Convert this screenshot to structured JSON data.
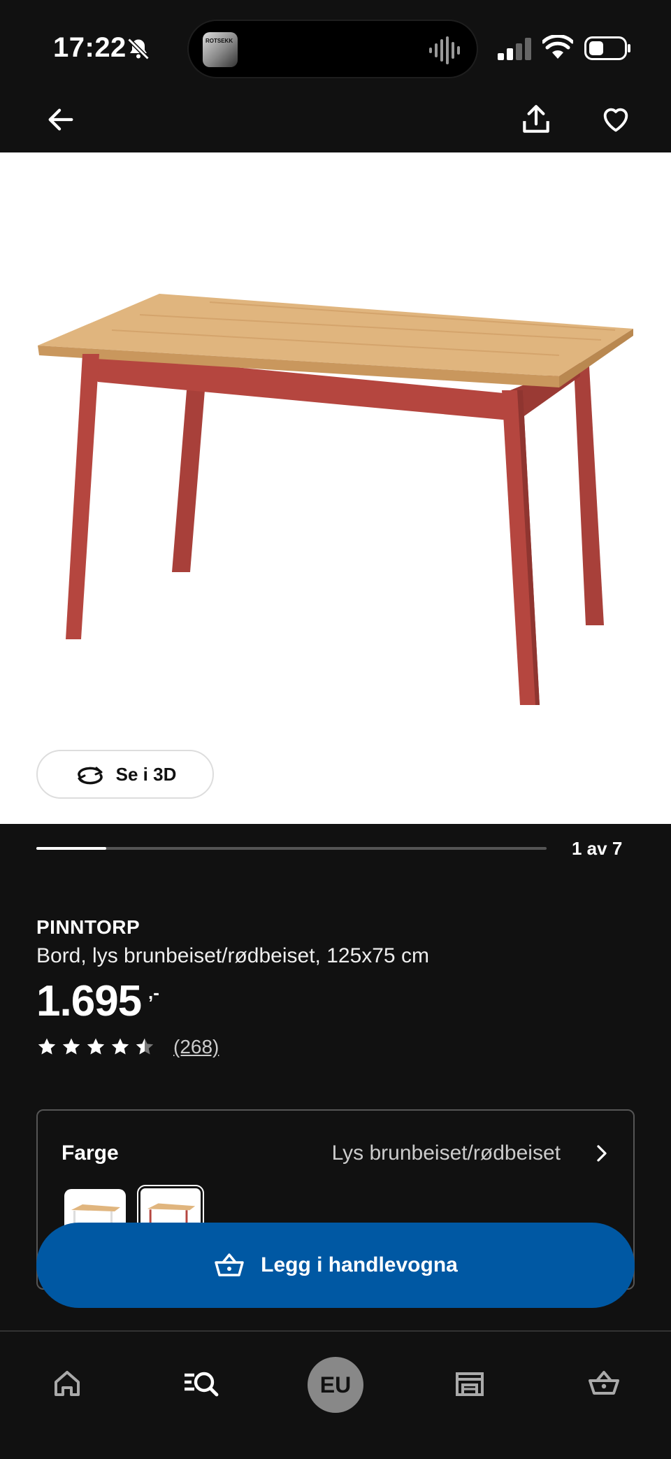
{
  "status_bar": {
    "time": "17:22",
    "icons": [
      "bell-off-icon",
      "signal-icon",
      "wifi-icon",
      "battery-icon"
    ],
    "now_playing_art_text": "ROTSEKK"
  },
  "app_bar": {
    "icons": [
      "back-arrow-icon",
      "share-icon",
      "heart-icon"
    ]
  },
  "hero": {
    "view_3d_label": "Se i 3D",
    "image_counter": "1 av 7",
    "image_progress": 0.137
  },
  "product": {
    "name": "PINNTORP",
    "description": "Bord, lys brunbeiset/rødbeiset, 125x75 cm",
    "price": "1.695",
    "price_suffix": ",-",
    "rating": 4.5,
    "rating_max": 5,
    "review_count": "(268)"
  },
  "color_option": {
    "label": "Farge",
    "selected_value": "Lys brunbeiset/rødbeiset",
    "swatches": [
      "white-leg-table",
      "red-leg-table"
    ],
    "selected_index": 1
  },
  "cart": {
    "label": "Legg i handlevogna"
  },
  "bottom_nav": {
    "items": [
      "home-icon",
      "search-icon",
      "profile-avatar",
      "store-icon",
      "basket-icon"
    ],
    "avatar_initials": "EU"
  },
  "colors": {
    "background": "#111111",
    "primary_button": "#0058a3",
    "table_top": "#e0b57e",
    "table_legs": "#b5463f"
  }
}
